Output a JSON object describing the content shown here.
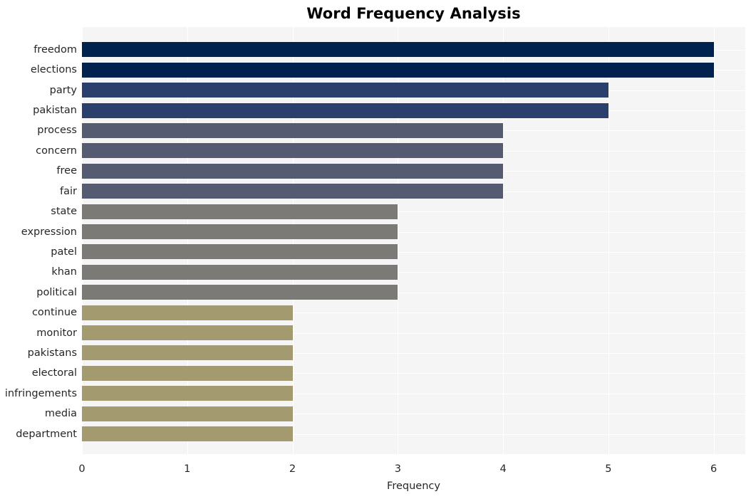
{
  "chart_data": {
    "type": "bar",
    "orientation": "horizontal",
    "title": "Word Frequency Analysis",
    "xlabel": "Frequency",
    "ylabel": "",
    "xlim": [
      0,
      6.3
    ],
    "xticks": [
      0,
      1,
      2,
      3,
      4,
      5,
      6
    ],
    "xticklabels": [
      "0",
      "1",
      "2",
      "3",
      "4",
      "5",
      "6"
    ],
    "grid": true,
    "legend": null,
    "categories": [
      "freedom",
      "elections",
      "party",
      "pakistan",
      "process",
      "concern",
      "free",
      "fair",
      "state",
      "expression",
      "patel",
      "khan",
      "political",
      "continue",
      "monitor",
      "pakistans",
      "electoral",
      "infringements",
      "media",
      "department"
    ],
    "values": [
      6,
      6,
      5,
      5,
      4,
      4,
      4,
      4,
      3,
      3,
      3,
      3,
      3,
      2,
      2,
      2,
      2,
      2,
      2,
      2
    ],
    "bar_colors": [
      "#00224e",
      "#00224e",
      "#2a3f6b",
      "#2a3f6b",
      "#555b70",
      "#555b70",
      "#555b70",
      "#555b70",
      "#7b7a76",
      "#7b7a76",
      "#7b7a76",
      "#7b7a76",
      "#7b7a76",
      "#a49a70",
      "#a49a70",
      "#a49a70",
      "#a49a70",
      "#a49a70",
      "#a49a70",
      "#a49a70"
    ],
    "plot_background": "#f5f5f5",
    "grid_color": "#ffffff",
    "figure_background": "#ffffff"
  }
}
